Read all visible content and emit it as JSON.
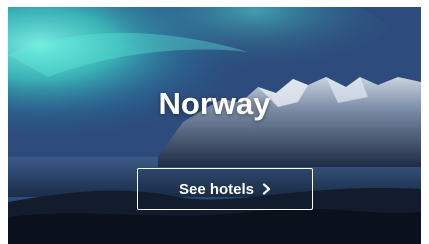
{
  "card": {
    "destination": "Norway",
    "cta_label": "See hotels",
    "cta_icon": "chevron-right-icon",
    "image_subject": "aurora over snowy mountains and sea"
  },
  "colors": {
    "aurora": "#3fe0d0",
    "sky": "#2f4f82",
    "text": "#ffffff"
  }
}
